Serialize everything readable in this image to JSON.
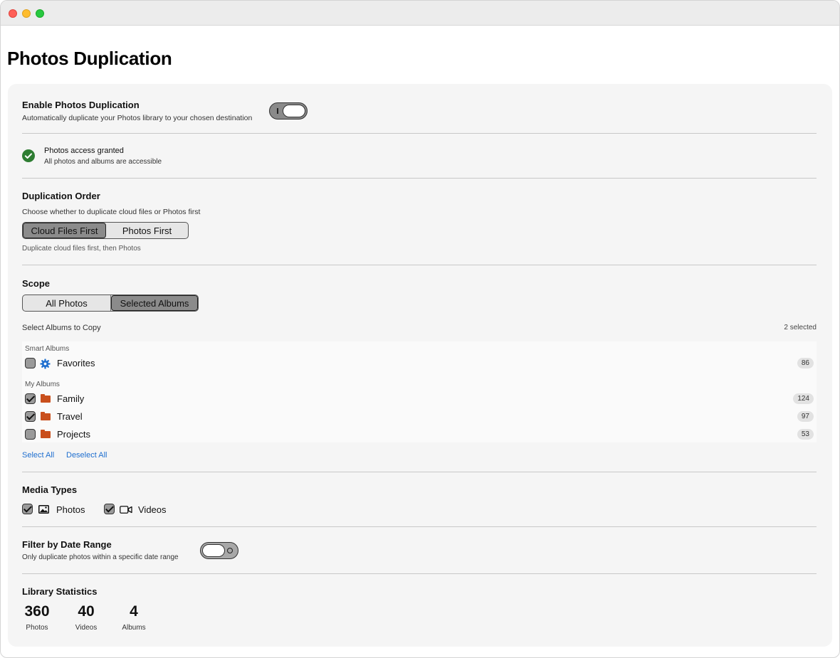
{
  "page": {
    "title": "Photos Duplication"
  },
  "enable": {
    "title": "Enable Photos Duplication",
    "subtitle": "Automatically duplicate your Photos library to your chosen destination",
    "on": true
  },
  "access": {
    "title": "Photos access granted",
    "subtitle": "All photos and albums are accessible",
    "icon": "checkmark-circle-icon",
    "color": "#2e7d32"
  },
  "order": {
    "title": "Duplication Order",
    "subtitle": "Choose whether to duplicate cloud files or Photos first",
    "options": [
      "Cloud Files First",
      "Photos First"
    ],
    "selected": "Cloud Files First",
    "hint": "Duplicate cloud files first, then Photos"
  },
  "scope": {
    "title": "Scope",
    "options": [
      "All Photos",
      "Selected Albums"
    ],
    "selected": "Selected Albums",
    "albums_label": "Select Albums to Copy",
    "selected_count": "2 selected",
    "groups": [
      {
        "label": "Smart Albums",
        "albums": [
          {
            "name": "Favorites",
            "count": "86",
            "checked": false,
            "icon": "gear-icon"
          }
        ]
      },
      {
        "label": "My Albums",
        "albums": [
          {
            "name": "Family",
            "count": "124",
            "checked": true,
            "icon": "folder-icon"
          },
          {
            "name": "Travel",
            "count": "97",
            "checked": true,
            "icon": "folder-icon"
          },
          {
            "name": "Projects",
            "count": "53",
            "checked": false,
            "icon": "folder-icon"
          }
        ]
      }
    ],
    "select_all": "Select All",
    "deselect_all": "Deselect All"
  },
  "media": {
    "title": "Media Types",
    "photos_label": "Photos",
    "videos_label": "Videos",
    "photos_checked": true,
    "videos_checked": true
  },
  "date_filter": {
    "title": "Filter by Date Range",
    "subtitle": "Only duplicate photos within a specific date range",
    "on": false
  },
  "stats": {
    "title": "Library Statistics",
    "items": [
      {
        "value": "360",
        "label": "Photos"
      },
      {
        "value": "40",
        "label": "Videos"
      },
      {
        "value": "4",
        "label": "Albums"
      }
    ]
  },
  "colors": {
    "accent": "#1f6fcf",
    "folder": "#c94f1c",
    "gear": "#1f6fcf"
  }
}
